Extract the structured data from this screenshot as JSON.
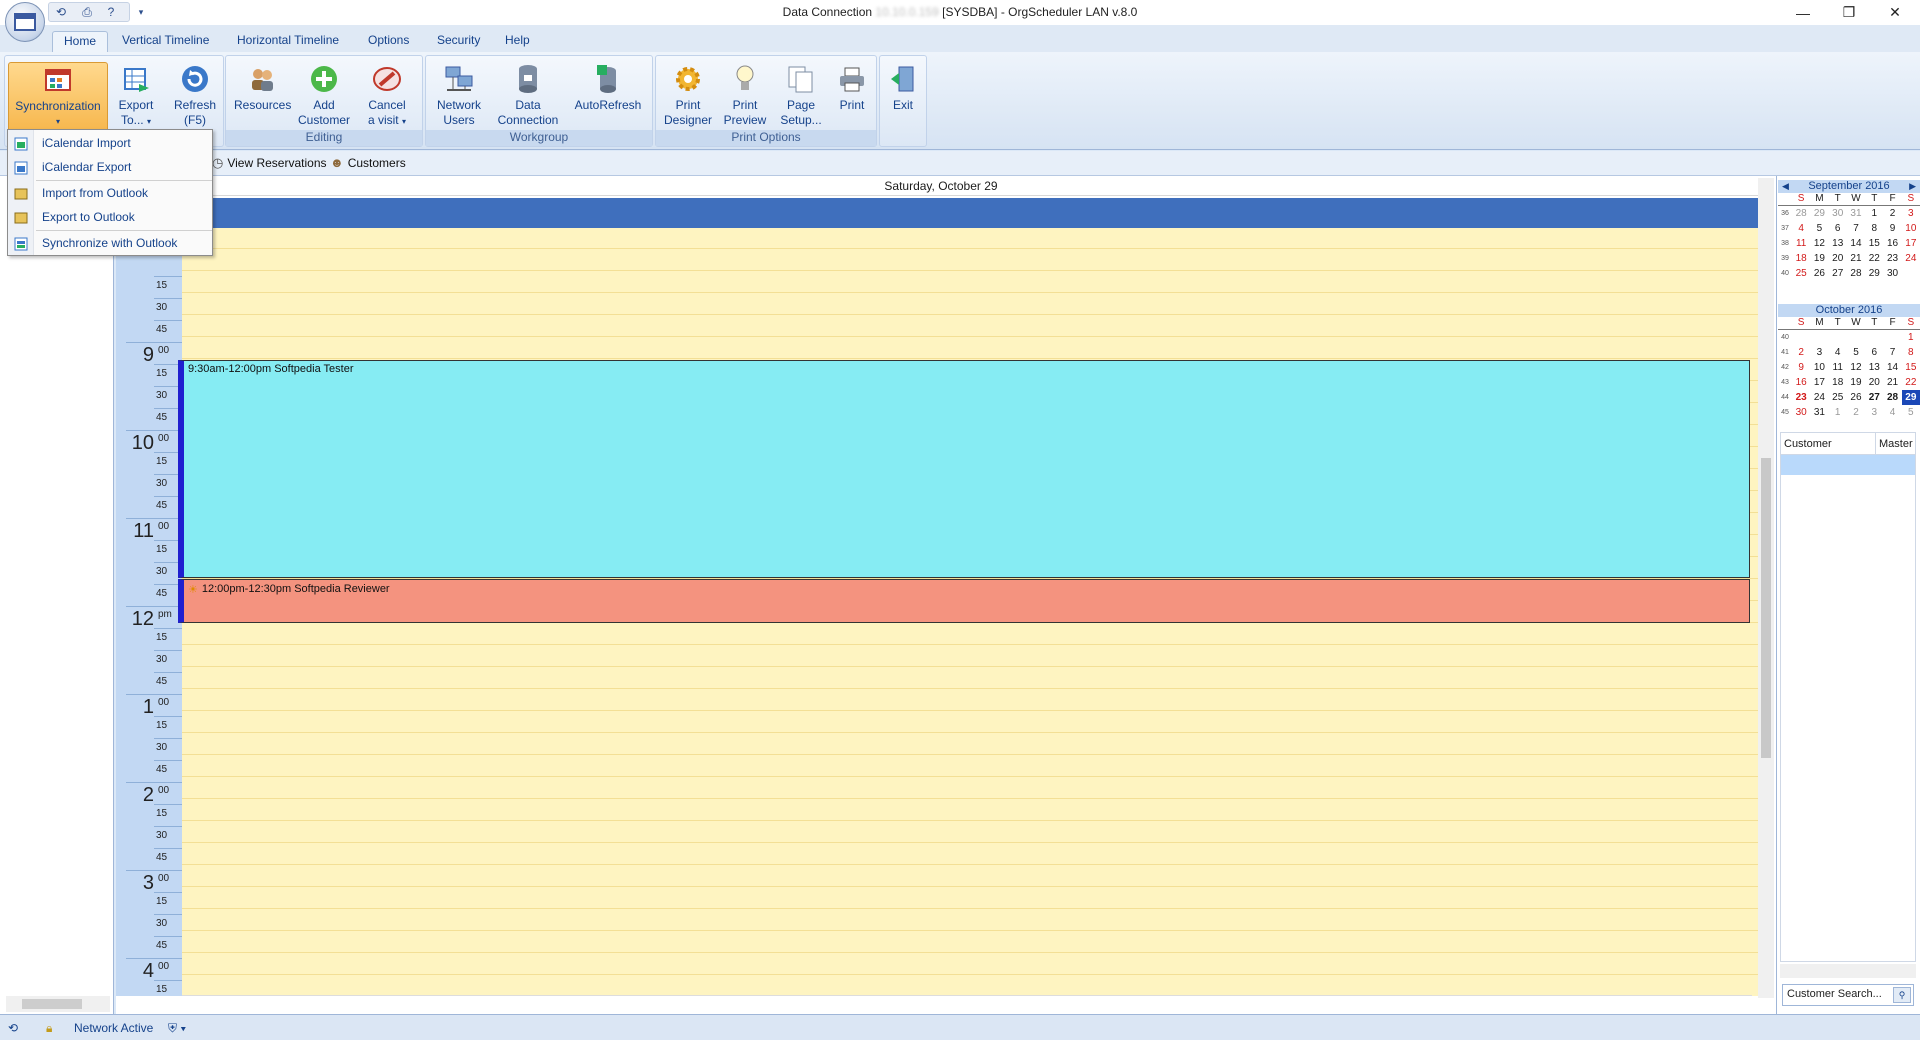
{
  "window": {
    "title_prefix": "Data Connection",
    "title_ip": "10.10.0.159",
    "title_suffix": "[SYSDBA] - OrgScheduler LAN v.8.0",
    "min_glyph": "—",
    "max_glyph": "❐",
    "close_glyph": "✕"
  },
  "tabs": [
    "Home",
    "Vertical Timeline",
    "Horizontal Timeline",
    "Options",
    "Security",
    "Help"
  ],
  "ribbon": {
    "sync_label": "Synchronization",
    "export_label_1": "Export",
    "export_label_2": "To...",
    "refresh_label_1": "Refresh",
    "refresh_label_2": "(F5)",
    "resources_label": "Resources",
    "add_customer_1": "Add",
    "add_customer_2": "Customer",
    "cancel_visit_1": "Cancel",
    "cancel_visit_2": "a visit",
    "editing_group": "Editing",
    "network_users_1": "Network",
    "network_users_2": "Users",
    "data_conn_1": "Data",
    "data_conn_2": "Connection",
    "autorefresh": "AutoRefresh",
    "workgroup_group": "Workgroup",
    "print_designer_1": "Print",
    "print_designer_2": "Designer",
    "print_preview_1": "Print",
    "print_preview_2": "Preview",
    "page_setup_1": "Page",
    "page_setup_2": "Setup...",
    "print_label": "Print",
    "print_options_group": "Print Options",
    "exit_label": "Exit"
  },
  "toolbar": {
    "view_reservations": "View Reservations",
    "customers": "Customers"
  },
  "menu": {
    "items": [
      "iCalendar Import",
      "iCalendar Export",
      "Import from Outlook",
      "Export to Outlook",
      "Synchronize with Outlook"
    ]
  },
  "dayview": {
    "date_header": "Saturday, October 29",
    "hours": [
      {
        "h": "9",
        "m": "00"
      },
      {
        "h": "10",
        "m": "00"
      },
      {
        "h": "11",
        "m": "00"
      },
      {
        "h": "12",
        "m": "pm"
      },
      {
        "h": "1",
        "m": "00"
      },
      {
        "h": "2",
        "m": "00"
      },
      {
        "h": "3",
        "m": "00"
      },
      {
        "h": "4",
        "m": "00"
      }
    ],
    "minute_marks": [
      "15",
      "30",
      "45"
    ],
    "appointments": [
      {
        "text": "9:30am-12:00pm Softpedia Tester",
        "color": "#86ecf3"
      },
      {
        "text": "12:00pm-12:30pm Softpedia Reviewer",
        "color": "#f4937f"
      }
    ]
  },
  "mini_calendars": [
    {
      "title": "September 2016",
      "dow": [
        "S",
        "M",
        "T",
        "W",
        "T",
        "F",
        "S"
      ],
      "weeks": [
        {
          "wk": "36",
          "days": [
            "28",
            "29",
            "30",
            "31",
            "1",
            "2",
            "3"
          ]
        },
        {
          "wk": "37",
          "days": [
            "4",
            "5",
            "6",
            "7",
            "8",
            "9",
            "10"
          ]
        },
        {
          "wk": "38",
          "days": [
            "11",
            "12",
            "13",
            "14",
            "15",
            "16",
            "17"
          ]
        },
        {
          "wk": "39",
          "days": [
            "18",
            "19",
            "20",
            "21",
            "22",
            "23",
            "24"
          ]
        },
        {
          "wk": "40",
          "days": [
            "25",
            "26",
            "27",
            "28",
            "29",
            "30",
            ""
          ]
        }
      ]
    },
    {
      "title": "October 2016",
      "dow": [
        "S",
        "M",
        "T",
        "W",
        "T",
        "F",
        "S"
      ],
      "weeks": [
        {
          "wk": "40",
          "days": [
            "",
            "",
            "",
            "",
            "",
            "",
            "1"
          ]
        },
        {
          "wk": "41",
          "days": [
            "2",
            "3",
            "4",
            "5",
            "6",
            "7",
            "8"
          ]
        },
        {
          "wk": "42",
          "days": [
            "9",
            "10",
            "11",
            "12",
            "13",
            "14",
            "15"
          ]
        },
        {
          "wk": "43",
          "days": [
            "16",
            "17",
            "18",
            "19",
            "20",
            "21",
            "22"
          ]
        },
        {
          "wk": "44",
          "days": [
            "23",
            "24",
            "25",
            "26",
            "27",
            "28",
            "29"
          ]
        },
        {
          "wk": "45",
          "days": [
            "30",
            "31",
            "1",
            "2",
            "3",
            "4",
            "5"
          ]
        }
      ]
    }
  ],
  "customer_panel": {
    "col1": "Customer",
    "col2": "Master",
    "search_placeholder": "Customer Search..."
  },
  "statusbar": {
    "network": "Network Active"
  },
  "colors": {
    "accent": "#15428b",
    "allday_bar": "#3f6fbd",
    "grid_bg": "#fef4c1",
    "selected_day": "#1b48b7"
  }
}
